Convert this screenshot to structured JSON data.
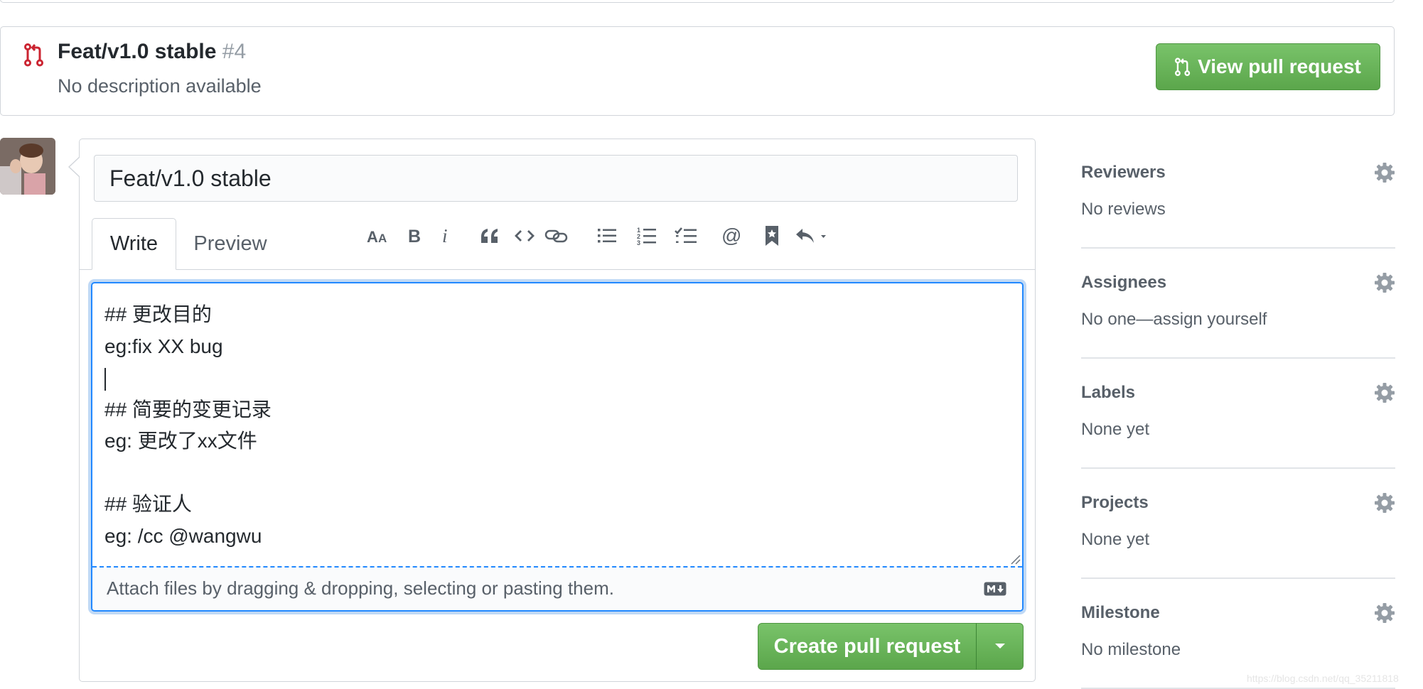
{
  "pr_banner": {
    "title": "Feat/v1.0 stable",
    "number": "#4",
    "description": "No description available",
    "view_button": "View pull request"
  },
  "composer": {
    "title_value": "Feat/v1.0 stable",
    "tabs": [
      {
        "label": "Write",
        "active": true
      },
      {
        "label": "Preview",
        "active": false
      }
    ],
    "toolbar_icons": [
      "header-icon",
      "bold-icon",
      "italic-icon",
      "quote-icon",
      "code-icon",
      "link-icon",
      "bullet-list-icon",
      "numbered-list-icon",
      "task-list-icon",
      "mention-icon",
      "saved-reply-icon",
      "reply-dropdown-icon"
    ],
    "body_lines": [
      "## 更改目的",
      "eg:fix XX bug",
      "",
      "## 简要的变更记录",
      "eg: 更改了xx文件",
      "",
      "## 验证人",
      "eg: /cc @wangwu"
    ],
    "attach_hint": "Attach files by dragging & dropping, selecting or pasting them.",
    "submit_label": "Create pull request"
  },
  "sidebar": {
    "sections": [
      {
        "title": "Reviewers",
        "value": "No reviews"
      },
      {
        "title": "Assignees",
        "value": "No one—assign yourself"
      },
      {
        "title": "Labels",
        "value": "None yet"
      },
      {
        "title": "Projects",
        "value": "None yet"
      },
      {
        "title": "Milestone",
        "value": "No milestone"
      }
    ]
  },
  "watermark": "https://blog.csdn.net/qq_35211818",
  "colors": {
    "accent_green": "#5ba64b",
    "focus_blue": "#2188ff",
    "pr_icon_red": "#cb2431",
    "muted_text": "#586069"
  }
}
